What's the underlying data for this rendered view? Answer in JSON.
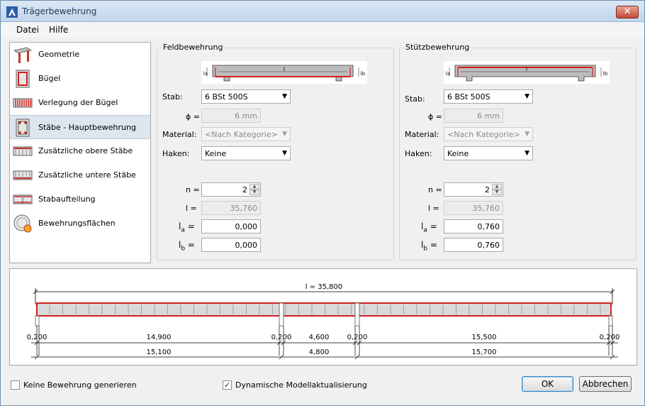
{
  "window": {
    "title": "Trägerbewehrung",
    "close_label": "✕"
  },
  "menu": {
    "items": [
      "Datei",
      "Hilfe"
    ]
  },
  "nav": {
    "items": [
      {
        "label": "Geometrie",
        "icon": "geometry-icon"
      },
      {
        "label": "Bügel",
        "icon": "stirrup-icon"
      },
      {
        "label": "Verlegung der Bügel",
        "icon": "stirrup-layout-icon"
      },
      {
        "label": "Stäbe - Hauptbewehrung",
        "icon": "main-bars-icon",
        "selected": true
      },
      {
        "label": "Zusätzliche obere Stäbe",
        "icon": "top-bars-icon"
      },
      {
        "label": "Zusätzliche untere Stäbe",
        "icon": "bottom-bars-icon"
      },
      {
        "label": "Stabaufteilung",
        "icon": "bar-distribution-icon"
      },
      {
        "label": "Bewehrungsflächen",
        "icon": "reinforcement-areas-icon"
      }
    ]
  },
  "feld": {
    "title": "Feldbewehrung",
    "diagram": {
      "l": "l",
      "la": "la",
      "lb": "lb"
    },
    "stab_label": "Stab:",
    "stab_value": "6 BSt 500S",
    "phi_label": "ϕ =",
    "phi_value": "6 mm",
    "material_label": "Material:",
    "material_value": "<Nach Kategorie>",
    "haken_label": "Haken:",
    "haken_value": "Keine",
    "n_label": "n =",
    "n_value": "2",
    "l_label": "l =",
    "l_value": "35,760",
    "la_label": "l",
    "la_sub": "a",
    "la_eq": "=",
    "la_value": "0,000",
    "lb_label": "l",
    "lb_sub": "b",
    "lb_eq": "=",
    "lb_value": "0,000"
  },
  "stuetz": {
    "title": "Stützbewehrung",
    "diagram": {
      "l": "l",
      "la": "la",
      "lb": "lb"
    },
    "stab_label": "Stab:",
    "stab_value": "6 BSt 500S",
    "phi_label": "ϕ =",
    "phi_value": "6 mm",
    "material_label": "Material:",
    "material_value": "<Nach Kategorie>",
    "haken_label": "Haken:",
    "haken_value": "Keine",
    "n_label": "n =",
    "n_value": "2",
    "l_label": "l =",
    "l_value": "35,760",
    "la_label": "l",
    "la_sub": "a",
    "la_eq": "=",
    "la_value": "0,760",
    "lb_label": "l",
    "lb_sub": "b",
    "lb_eq": "=",
    "lb_value": "0,760"
  },
  "preview": {
    "total": "l = 35,800",
    "dims_upper": [
      "0,200",
      "14,900",
      "0,200",
      "4,600",
      "0,200",
      "15,500",
      "0,200"
    ],
    "dims_lower": [
      "15,100",
      "4,800",
      "15,700"
    ]
  },
  "footer": {
    "no_reinforcement_label": "Keine Bewehrung generieren",
    "no_reinforcement_checked": false,
    "dynamic_update_label": "Dynamische Modellaktualisierung",
    "dynamic_update_checked": true,
    "ok_label": "OK",
    "cancel_label": "Abbrechen"
  },
  "colors": {
    "accent_red": "#d02020",
    "bar_fill": "#d9d9d9",
    "selection": "#dde5ef"
  }
}
